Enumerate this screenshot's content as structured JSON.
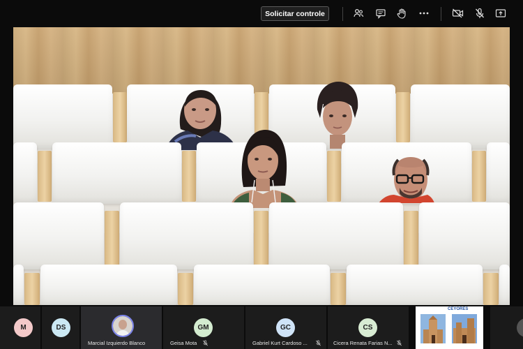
{
  "toolbar": {
    "request_control_label": "Solicitar controle",
    "icons": [
      "people-icon",
      "chat-icon",
      "raise-hand-icon",
      "more-icon",
      "camera-off-icon",
      "mic-off-icon",
      "share-icon"
    ]
  },
  "participants": [
    {
      "initials": "M",
      "name": "",
      "avatar_color": "#f3c9c9"
    },
    {
      "initials": "DS",
      "name": "",
      "avatar_color": "#cbe8f3"
    },
    {
      "initials": "",
      "name": "Marcial Izquierdo Blanco",
      "avatar_color": "#ffffff"
    },
    {
      "initials": "GM",
      "name": "Geisa Mota",
      "avatar_color": "#d4ecd0"
    },
    {
      "initials": "GC",
      "name": "Gabriel Kurt Cardoso ...",
      "avatar_color": "#cfe3f7"
    },
    {
      "initials": "CS",
      "name": "Cicera Renata Farias N...",
      "avatar_color": "#d8ecd3"
    }
  ],
  "shared_content": {
    "brand": "CEYORES"
  }
}
